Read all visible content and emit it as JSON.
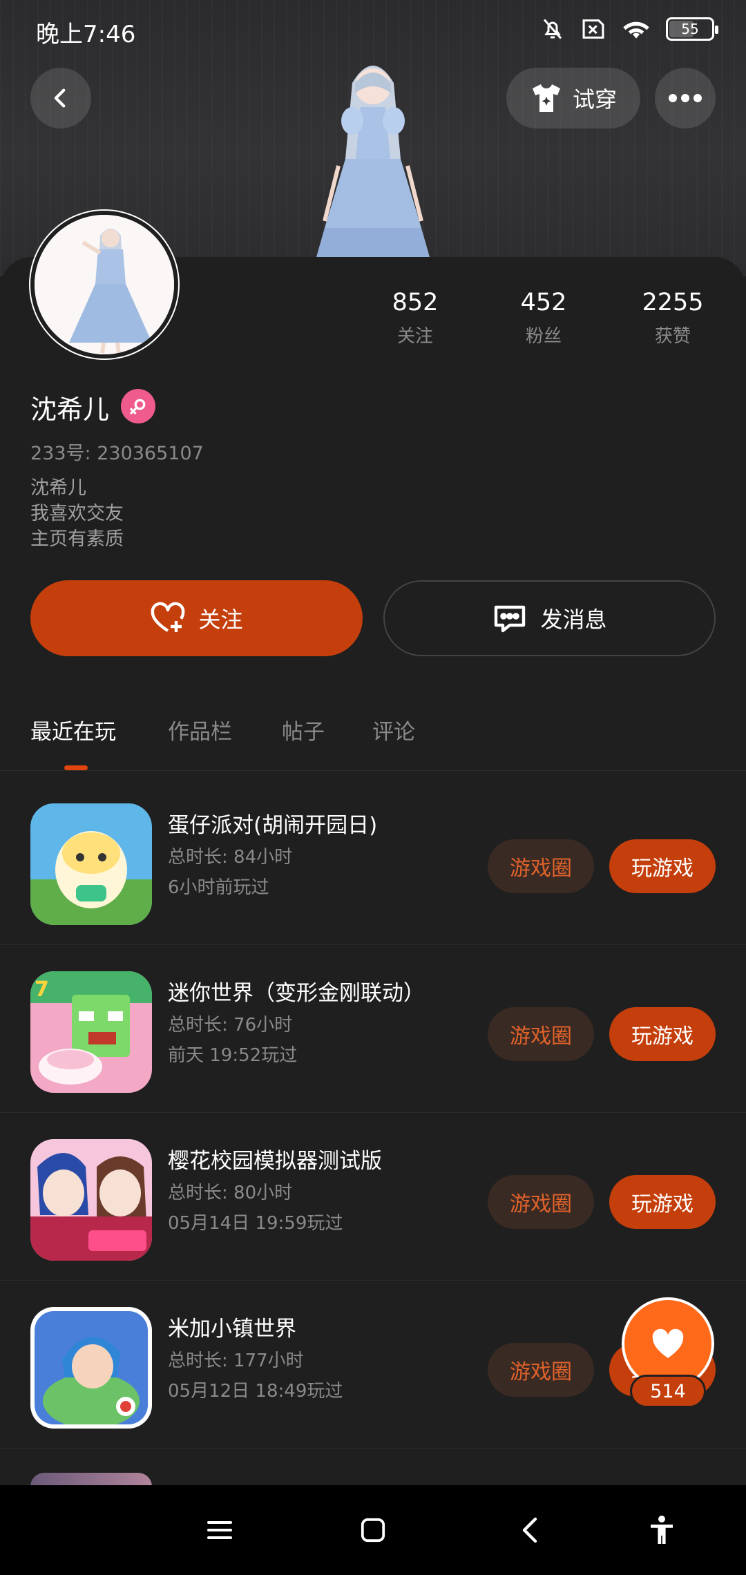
{
  "status_bar": {
    "time": "晚上7:46",
    "battery": "55",
    "battery_fraction": 0.55,
    "icons": [
      "bell-off-icon",
      "sim-x-icon",
      "wifi-icon",
      "battery-icon"
    ]
  },
  "header": {
    "try_on_label": "试穿"
  },
  "profile": {
    "stats": [
      {
        "value": "852",
        "label": "关注"
      },
      {
        "value": "452",
        "label": "粉丝"
      },
      {
        "value": "2255",
        "label": "获赞"
      }
    ],
    "name": "沈希儿",
    "gender_icon": "female-icon",
    "gender_color": "#f05b8d",
    "id_text": "233号: 230365107",
    "bio": [
      "沈希儿",
      "我喜欢交友",
      "主页有素质"
    ]
  },
  "actions": {
    "follow_label": "关注",
    "message_label": "发消息",
    "accent_color": "#c53f0d"
  },
  "tabs": [
    {
      "label": "最近在玩",
      "active": true
    },
    {
      "label": "作品栏",
      "active": false
    },
    {
      "label": "帖子",
      "active": false
    },
    {
      "label": "评论",
      "active": false
    }
  ],
  "games": [
    {
      "title": "蛋仔派对(胡闹开园日)",
      "duration": "总时长: 84小时",
      "last_played": "6小时前玩过",
      "circle_label": "游戏圈",
      "play_label": "玩游戏"
    },
    {
      "title": "迷你世界（变形金刚联动）",
      "duration": "总时长: 76小时",
      "last_played": "前天 19:52玩过",
      "circle_label": "游戏圈",
      "play_label": "玩游戏"
    },
    {
      "title": "樱花校园模拟器测试版",
      "duration": "总时长: 80小时",
      "last_played": "05月14日 19:59玩过",
      "circle_label": "游戏圈",
      "play_label": "玩游戏"
    },
    {
      "title": "米加小镇世界",
      "duration": "总时长: 177小时",
      "last_played": "05月12日 18:49玩过",
      "circle_label": "游戏圈",
      "play_label": "玩游戏"
    }
  ],
  "like_fab": {
    "count": "514",
    "icon": "heart-icon"
  },
  "nav_bar": {
    "icons": [
      "menu-icon",
      "home-icon",
      "back-icon",
      "accessibility-icon"
    ]
  }
}
